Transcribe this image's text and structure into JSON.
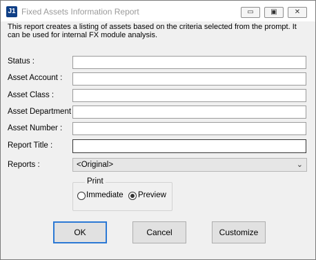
{
  "window": {
    "title": "Fixed Assets Information Report",
    "app_icon_text": "J1",
    "controls": {
      "minimize": "▭",
      "restore": "▣",
      "close": "✕"
    }
  },
  "description": "This report creates a listing of assets based on the criteria selected from the prompt.  It can be used for internal FX module analysis.",
  "form": {
    "status": {
      "label": "Status :",
      "value": ""
    },
    "asset_account": {
      "label": "Asset Account  :",
      "value": ""
    },
    "asset_class": {
      "label": "Asset Class :",
      "value": ""
    },
    "asset_department": {
      "label": "Asset Department :",
      "value": ""
    },
    "asset_number": {
      "label": "Asset Number :",
      "value": ""
    },
    "report_title": {
      "label": "Report Title :",
      "value": ""
    },
    "reports": {
      "label": "Reports :",
      "selected": "<Original>",
      "arrow": "⌄"
    }
  },
  "print": {
    "legend": "Print",
    "options": [
      {
        "label": "Immediate",
        "checked": false
      },
      {
        "label": "Preview",
        "checked": true
      }
    ]
  },
  "buttons": {
    "ok": "OK",
    "cancel": "Cancel",
    "customize": "Customize"
  },
  "colors": {
    "accent": "#2a78d4",
    "dialog_bg": "#f0f0f0",
    "title_text": "#9a9a9a"
  }
}
